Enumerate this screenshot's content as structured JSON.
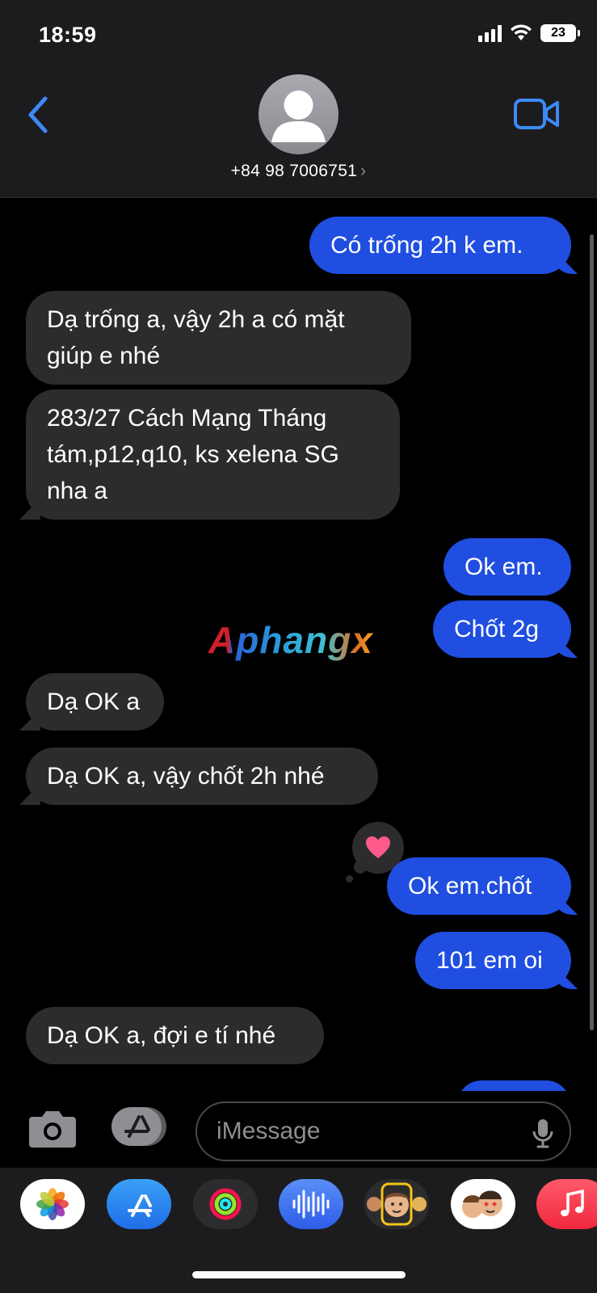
{
  "status_bar": {
    "time": "18:59",
    "battery": "23"
  },
  "header": {
    "contact_number": "+84 98 7006751",
    "chevron": "›",
    "back_icon": "chevron-left-icon",
    "video_icon": "video-camera-icon",
    "avatar_icon": "person-avatar-icon"
  },
  "messages": [
    {
      "direction": "outgoing",
      "text": "Có trống 2h k em."
    },
    {
      "direction": "incoming",
      "lines": [
        "Dạ trống a, vậy 2h a có mặt",
        "giúp e nhé"
      ]
    },
    {
      "direction": "incoming",
      "lines": [
        "283/27 Cách Mạng Tháng",
        "tám,p12,q10, ks xelena SG",
        "nha a"
      ]
    },
    {
      "direction": "outgoing",
      "text": "Ok em."
    },
    {
      "direction": "outgoing",
      "text": "Chốt 2g"
    },
    {
      "direction": "incoming",
      "text": "Dạ OK a"
    },
    {
      "direction": "incoming",
      "text": "Dạ OK a, vậy chốt 2h nhé"
    },
    {
      "direction": "outgoing",
      "text": "Ok em.chốt",
      "reaction": "heart"
    },
    {
      "direction": "outgoing",
      "text": "101 em oi"
    },
    {
      "direction": "incoming",
      "text": "Dạ OK a, đợi e tí nhé"
    }
  ],
  "watermark": "Aphangx",
  "input": {
    "placeholder": "iMessage",
    "camera_icon": "camera-icon",
    "apps_icon": "app-store-icon",
    "mic_icon": "microphone-icon"
  },
  "app_strip": [
    "photos-icon",
    "app-store-icon",
    "fitness-icon",
    "voice-memo-icon",
    "memoji-icon",
    "memoji-stickers-icon",
    "music-icon"
  ],
  "colors": {
    "outgoing_bubble": "#1f4ee0",
    "incoming_bubble": "#2c2c2e",
    "accent": "#3d8af7",
    "reaction_heart": "#ff5a8a"
  }
}
